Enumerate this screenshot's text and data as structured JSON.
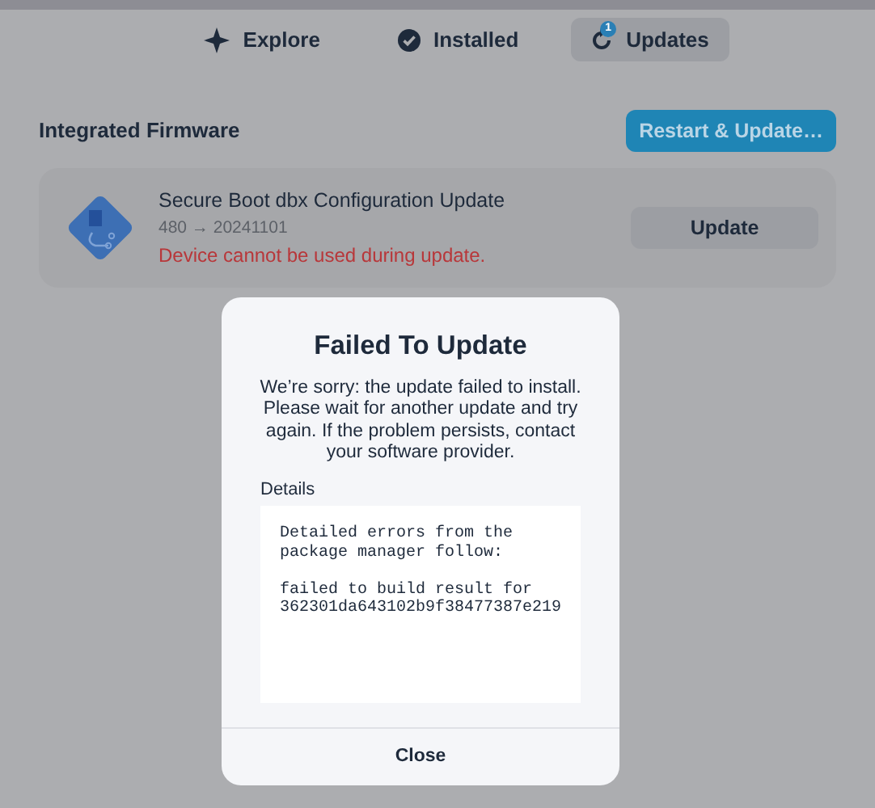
{
  "tabs": [
    {
      "label": "Explore",
      "kind": "explore",
      "selected": false
    },
    {
      "label": "Installed",
      "kind": "installed",
      "selected": false
    },
    {
      "label": "Updates",
      "kind": "updates",
      "selected": true,
      "badge": "1"
    }
  ],
  "section": {
    "title": "Integrated Firmware",
    "action": "Restart & Update…"
  },
  "updates": [
    {
      "name": "Secure Boot dbx Configuration Update",
      "version": "480 → 20241101",
      "warning": "Device cannot be used during update.",
      "button": "Update"
    }
  ],
  "dialog": {
    "title": "Failed To Update",
    "message": "We’re sorry: the update failed to install. Please wait for another update and try again. If the problem persists, contact your software provider.",
    "details_label": "Details",
    "details_paragraphs": [
      [
        "Detailed errors from the",
        "package manager follow:"
      ],
      [
        "failed to build result for",
        "362301da643102b9f38477387e219"
      ]
    ],
    "button": "Close"
  }
}
